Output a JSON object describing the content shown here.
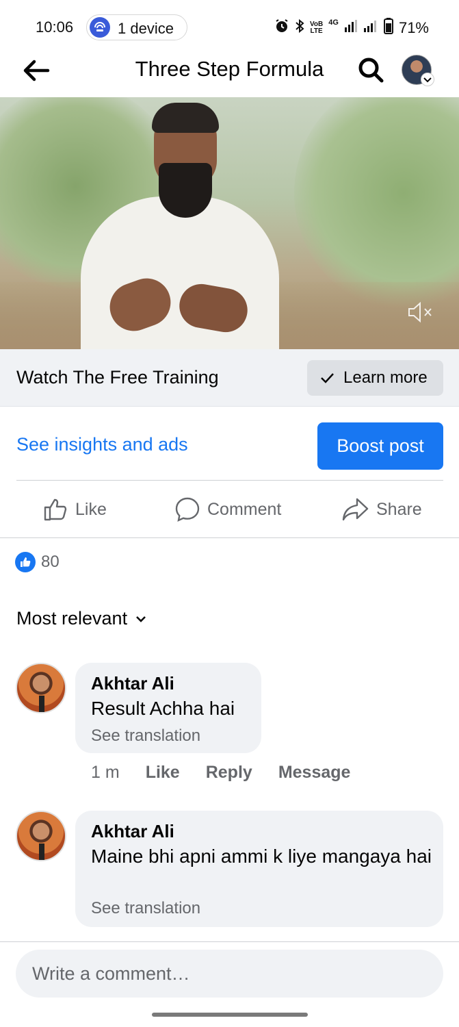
{
  "status_bar": {
    "time": "10:06",
    "device_pill": "1 device",
    "network_small_1": "VoB",
    "network_small_2": "LTE",
    "network_type": "4G",
    "battery": "71%"
  },
  "header": {
    "title": "Three Step Formula"
  },
  "cta": {
    "text": "Watch The Free Training",
    "button_label": "Learn more"
  },
  "insights": {
    "link_label": "See insights and ads",
    "boost_label": "Boost post"
  },
  "actions": {
    "like": "Like",
    "comment": "Comment",
    "share": "Share"
  },
  "reactions": {
    "count": "80"
  },
  "sort": {
    "label": "Most relevant"
  },
  "comments": [
    {
      "author": "Akhtar Ali",
      "text": "Result Achha hai",
      "translate": "See translation",
      "time": "1 m",
      "like": "Like",
      "reply": "Reply",
      "message": "Message"
    },
    {
      "author": "Akhtar Ali",
      "text": "Maine bhi apni ammi k liye mangaya hai",
      "translate": "See translation"
    }
  ],
  "composer": {
    "placeholder": "Write a comment…"
  },
  "colors": {
    "accent": "#1877f2",
    "secondary_text": "#65676b",
    "surface": "#f0f2f5"
  }
}
